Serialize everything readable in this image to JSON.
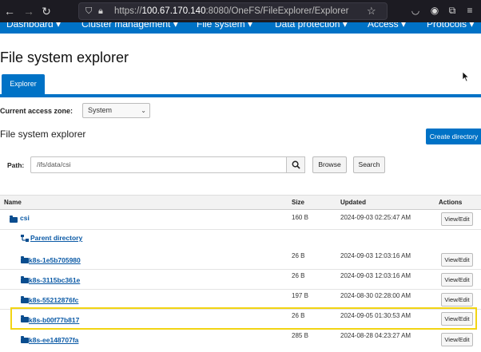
{
  "browser": {
    "url_prefix": "https://",
    "url_host": "100.67.170.140",
    "url_path": ":8080/OneFS/FileExplorer/Explorer"
  },
  "app_nav": {
    "items": [
      "Dashboard ▾",
      "Cluster management ▾",
      "File system ▾",
      "Data protection ▾",
      "Access ▾",
      "Protocols ▾"
    ]
  },
  "page": {
    "title": "File system explorer",
    "tab": "Explorer",
    "zone_label": "Current access zone:",
    "zone_value": "System",
    "section_title": "File system explorer",
    "create_button": "Create directory"
  },
  "path_bar": {
    "label": "Path:",
    "value": "/ifs/data/csi",
    "browse_button": "Browse",
    "search_button": "Search"
  },
  "table": {
    "headers": {
      "name": "Name",
      "size": "Size",
      "updated": "Updated",
      "actions": "Actions"
    },
    "rows": [
      {
        "name": "csi",
        "size": "160 B",
        "updated": "2024-09-03 02:25:47 AM",
        "action": "View/Edit"
      },
      {
        "name": "Parent directory",
        "size": "",
        "updated": "",
        "action": ""
      },
      {
        "name": "k8s-1e5b705980",
        "size": "26 B",
        "updated": "2024-09-03 12:03:16 AM",
        "action": "View/Edit"
      },
      {
        "name": "k8s-3115bc361e",
        "size": "26 B",
        "updated": "2024-09-03 12:03:16 AM",
        "action": "View/Edit"
      },
      {
        "name": "k8s-55212876fc",
        "size": "197 B",
        "updated": "2024-08-30 02:28:00 AM",
        "action": "View/Edit"
      },
      {
        "name": "k8s-b00f77b817",
        "size": "26 B",
        "updated": "2024-09-05 01:30:53 AM",
        "action": "View/Edit"
      },
      {
        "name": "k8s-ee148707fa",
        "size": "285 B",
        "updated": "2024-08-28 04:23:27 AM",
        "action": "View/Edit"
      }
    ]
  },
  "colors": {
    "brand_blue": "#0072c6",
    "highlight": "#f2d413",
    "link": "#0b5aa6"
  }
}
